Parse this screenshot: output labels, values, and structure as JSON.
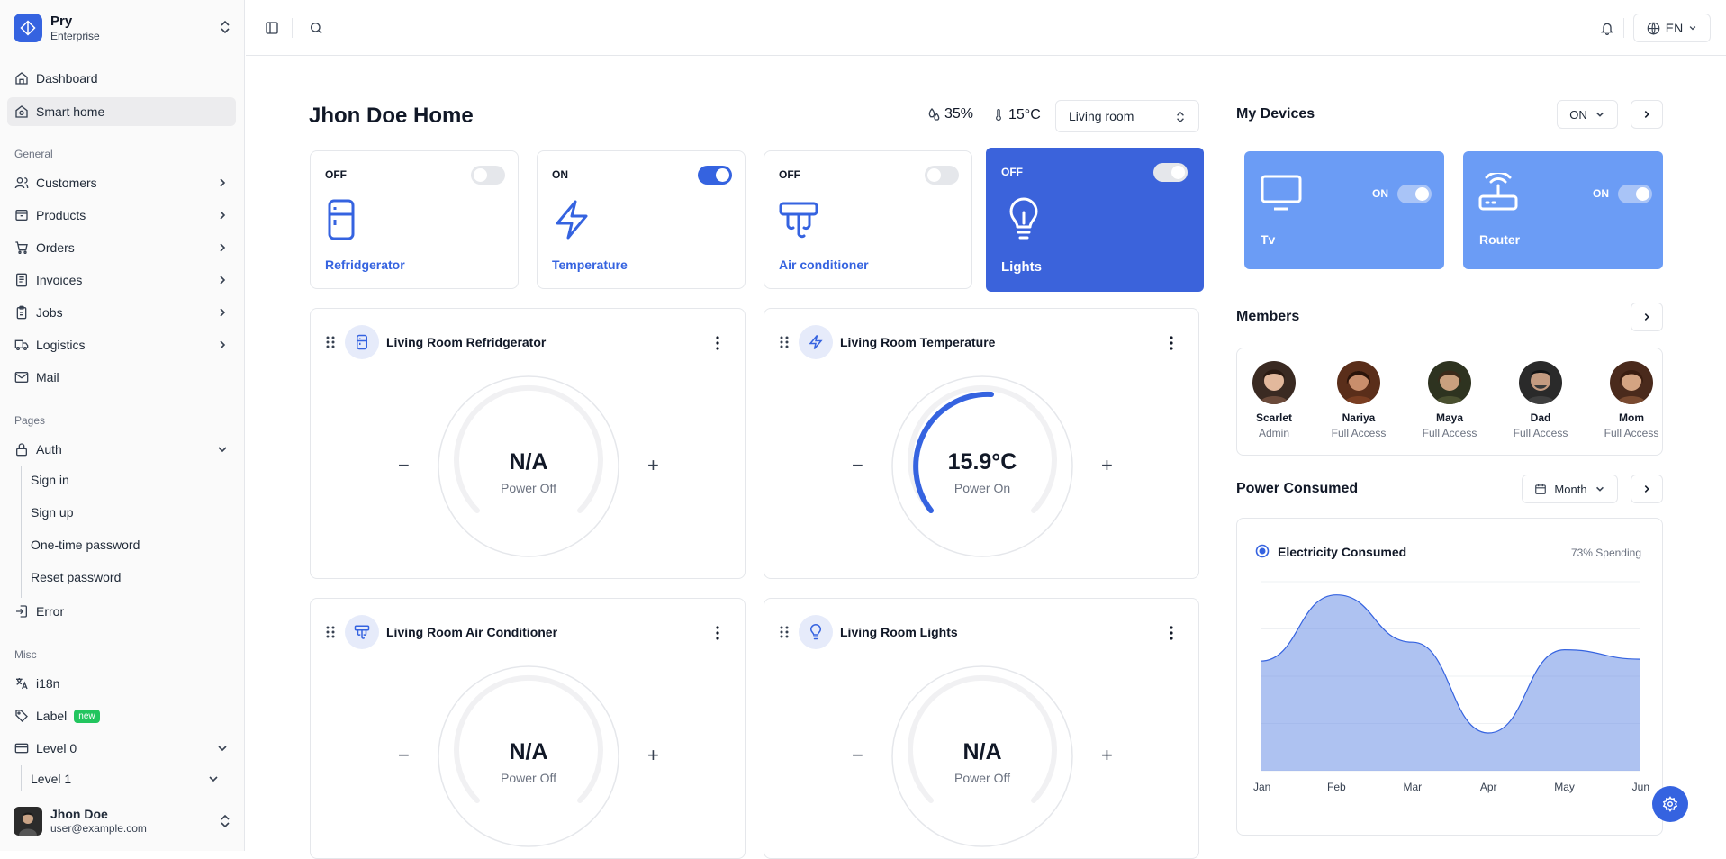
{
  "brand": {
    "name": "Pry",
    "plan": "Enterprise"
  },
  "nav": {
    "top": [
      {
        "label": "Dashboard",
        "icon": "home-icon"
      },
      {
        "label": "Smart home",
        "icon": "smart-home-icon"
      }
    ],
    "general_label": "General",
    "general": [
      {
        "label": "Customers",
        "icon": "users-icon"
      },
      {
        "label": "Products",
        "icon": "box-icon"
      },
      {
        "label": "Orders",
        "icon": "cart-icon"
      },
      {
        "label": "Invoices",
        "icon": "invoice-icon"
      },
      {
        "label": "Jobs",
        "icon": "clipboard-icon"
      },
      {
        "label": "Logistics",
        "icon": "truck-icon"
      },
      {
        "label": "Mail",
        "icon": "mail-icon"
      }
    ],
    "pages_label": "Pages",
    "auth": {
      "label": "Auth",
      "children": [
        "Sign in",
        "Sign up",
        "One-time password",
        "Reset password"
      ]
    },
    "error": "Error",
    "misc_label": "Misc",
    "i18n": "i18n",
    "label_item": "Label",
    "label_badge": "new",
    "level0": "Level 0",
    "level1": "Level 1"
  },
  "user": {
    "name": "Jhon Doe",
    "email": "user@example.com"
  },
  "topbar": {
    "lang": "EN"
  },
  "home": {
    "title": "Jhon Doe Home",
    "humidity": "35%",
    "temperature": "15°C",
    "room": "Living room"
  },
  "devices": [
    {
      "state": "OFF",
      "label": "Refridgerator",
      "on": false
    },
    {
      "state": "ON",
      "label": "Temperature",
      "on": true
    },
    {
      "state": "OFF",
      "label": "Air conditioner",
      "on": false
    },
    {
      "state": "OFF",
      "label": "Lights",
      "on": false,
      "selected": true
    }
  ],
  "panels": [
    {
      "title": "Living Room Refridgerator",
      "value": "N/A",
      "status": "Power Off",
      "level": 0
    },
    {
      "title": "Living Room Temperature",
      "value": "15.9°C",
      "status": "Power On",
      "level": 0.32
    },
    {
      "title": "Living Room Air Conditioner",
      "value": "N/A",
      "status": "Power Off",
      "level": 0
    },
    {
      "title": "Living Room Lights",
      "value": "N/A",
      "status": "Power Off",
      "level": 0
    }
  ],
  "my_devices": {
    "title": "My Devices",
    "filter": "ON",
    "items": [
      {
        "name": "Tv",
        "state": "ON"
      },
      {
        "name": "Router",
        "state": "ON"
      }
    ]
  },
  "members": {
    "title": "Members",
    "items": [
      {
        "name": "Scarlet",
        "role": "Admin"
      },
      {
        "name": "Nariya",
        "role": "Full Access"
      },
      {
        "name": "Maya",
        "role": "Full Access"
      },
      {
        "name": "Dad",
        "role": "Full Access"
      },
      {
        "name": "Mom",
        "role": "Full Access"
      }
    ]
  },
  "power": {
    "title": "Power Consumed",
    "period": "Month",
    "legend": "Electricity Consumed",
    "spending": "73% Spending"
  },
  "chart_data": {
    "type": "area",
    "categories": [
      "Jan",
      "Feb",
      "Mar",
      "Apr",
      "May",
      "Jun"
    ],
    "series": [
      {
        "name": "Electricity Consumed",
        "values": [
          58,
          93,
          68,
          20,
          64,
          59
        ]
      }
    ],
    "ylim": [
      0,
      100
    ],
    "grid": true,
    "color": "#6b8fe6"
  },
  "colors": {
    "accent": "#3563e0",
    "selected_card": "#3b63db",
    "device_card": "#6b9cf5"
  }
}
